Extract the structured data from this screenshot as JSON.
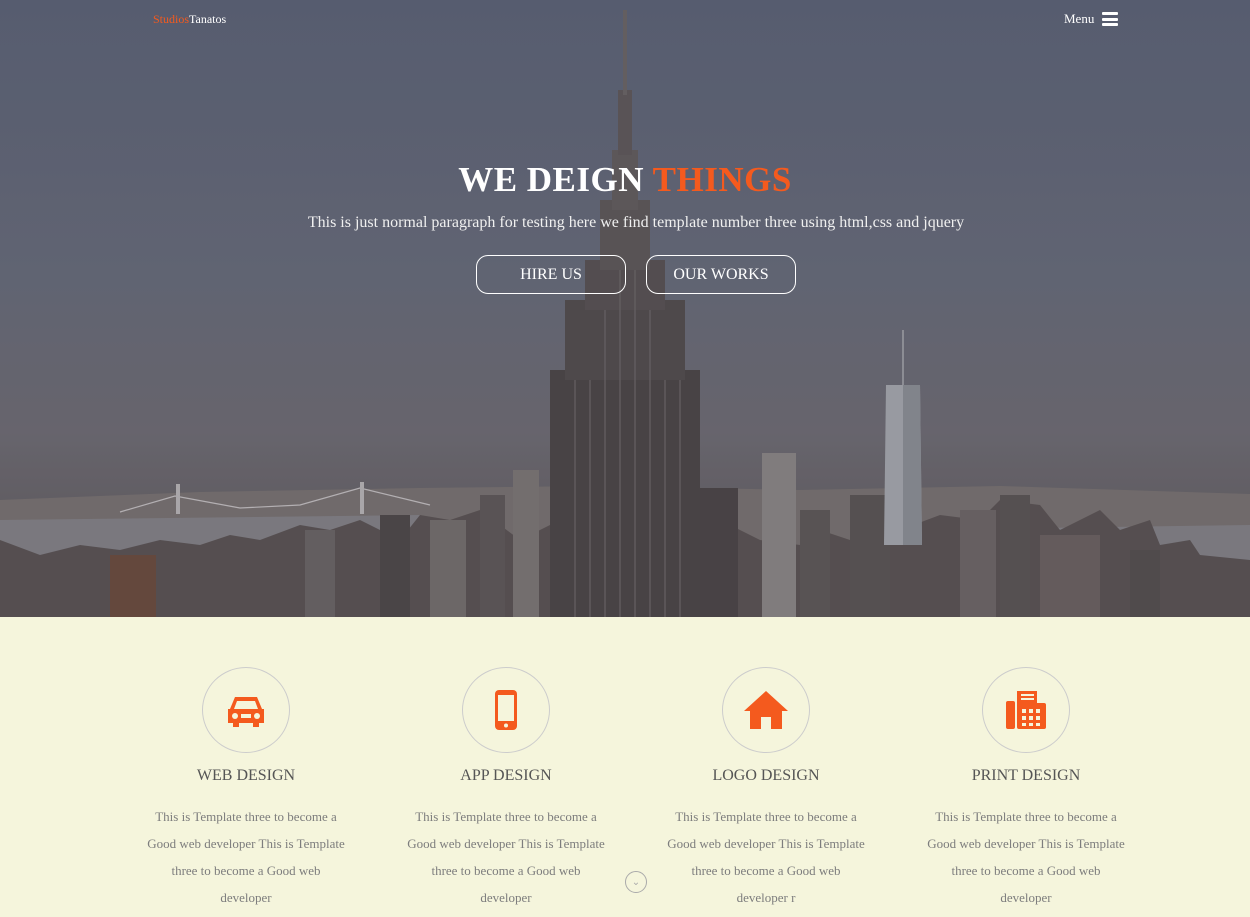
{
  "brand": {
    "part1": "Studios",
    "part2": "Tanatos"
  },
  "nav": {
    "menu_label": "Menu"
  },
  "hero": {
    "title_main": "WE DEIGN",
    "title_accent": "THINGS",
    "subtitle": "This is just normal paragraph for testing here we find template number three using html,css and jquery",
    "button_hire": "HIRE US",
    "button_works": "OUR WORKS"
  },
  "services": [
    {
      "icon": "car-icon",
      "title": "WEB DESIGN",
      "text": "This is Template three to become a Good web developer This is Template three to become a Good web developer"
    },
    {
      "icon": "mobile-icon",
      "title": "APP DESIGN",
      "text": "This is Template three to become a Good web developer This is Template three to become a Good web developer"
    },
    {
      "icon": "home-icon",
      "title": "LOGO DESIGN",
      "text": "This is Template three to become a Good web developer This is Template three to become a Good web developer r"
    },
    {
      "icon": "fax-icon",
      "title": "PRINT DESIGN",
      "text": "This is Template three to become a Good web developer This is Template three to become a Good web developer"
    }
  ],
  "colors": {
    "accent": "#f45a1e",
    "section_bg": "#f5f5dc"
  }
}
